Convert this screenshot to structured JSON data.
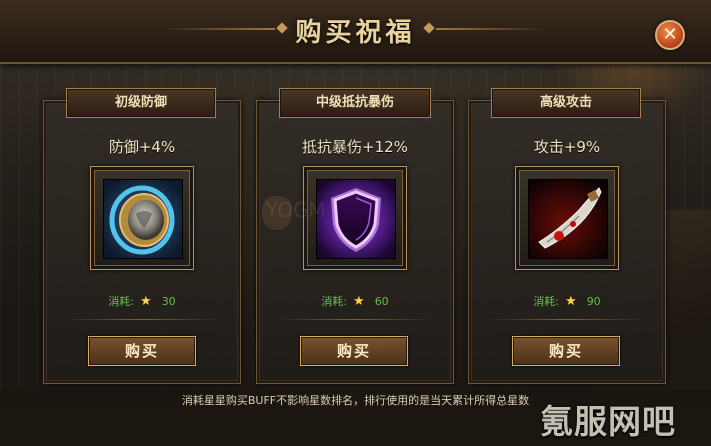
{
  "dialog": {
    "title": "购买祝福",
    "close_icon": "close-icon",
    "note": "消耗星星购买BUFF不影响星数排名，排行使用的是当天累计所得总星数"
  },
  "cards": [
    {
      "title": "初级防御",
      "effect": "防御+4%",
      "icon": "shield-round-icon",
      "cost_label": "消耗:",
      "cost_value": "30",
      "button": "购买"
    },
    {
      "title": "中级抵抗暴伤",
      "effect": "抵抗暴伤+12%",
      "icon": "purple-shield-icon",
      "cost_label": "消耗:",
      "cost_value": "60",
      "button": "购买"
    },
    {
      "title": "高级攻击",
      "effect": "攻击+9%",
      "icon": "bloody-blade-icon",
      "cost_label": "消耗:",
      "cost_value": "90",
      "button": "购买"
    }
  ],
  "watermark": {
    "corner": "氪服网吧",
    "center": "YOGM"
  },
  "colors": {
    "title": "#e8d2a0",
    "cost": "#5ec24a",
    "star": "#ffd34a",
    "frame_gold": "#b9935f",
    "close": "#d55a2a"
  }
}
